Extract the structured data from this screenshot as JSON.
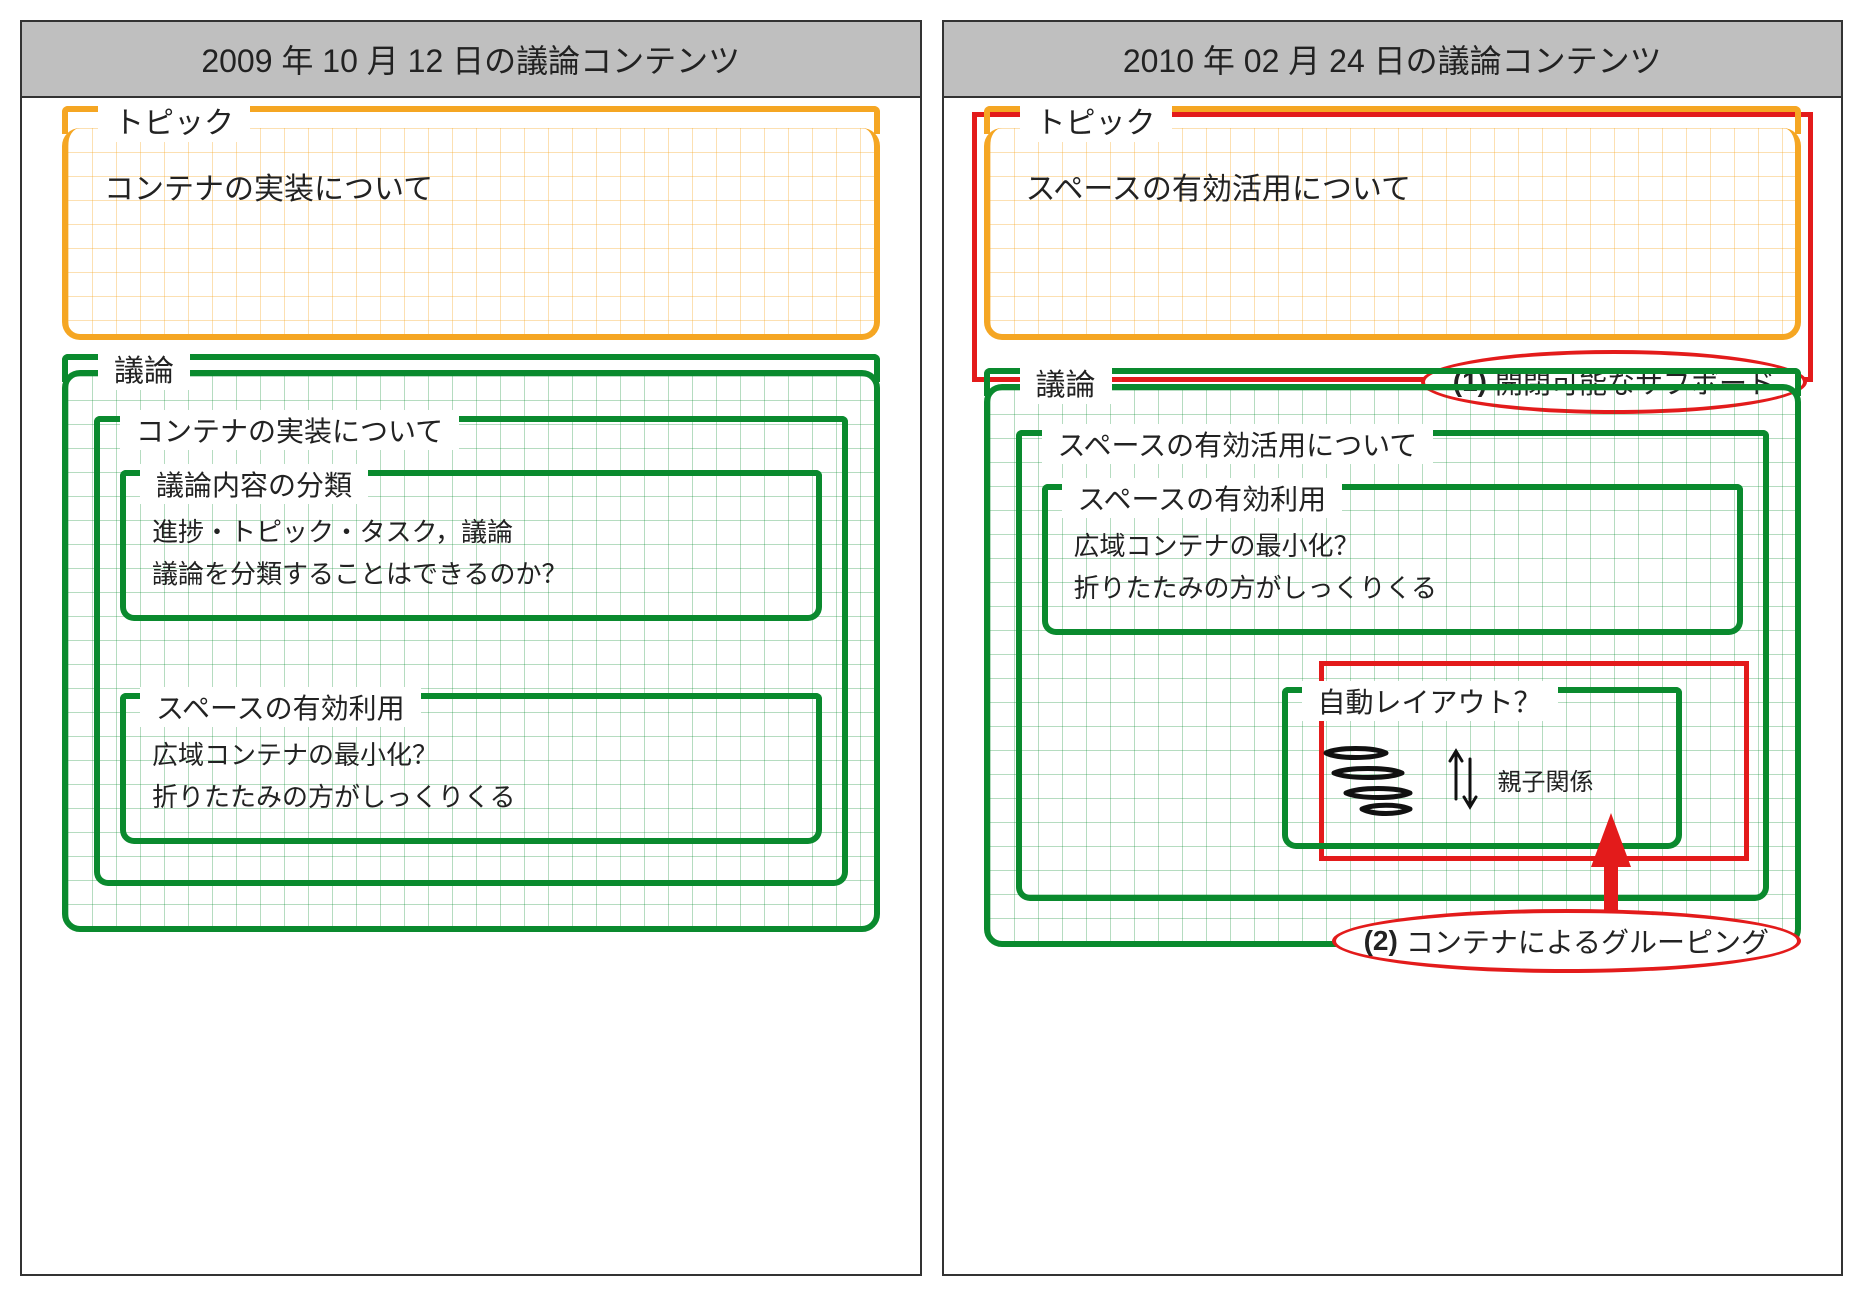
{
  "left": {
    "header": "2009 年 10 月 12 日の議論コンテンツ",
    "topic_label": "トピック",
    "topic_text": "コンテナの実装について",
    "discussion_label": "議論",
    "sub_title": "コンテナの実装について",
    "box1_label": "議論内容の分類",
    "box1_line1": "進捗・トピック・タスク，議論",
    "box1_line2": "議論を分類することはできるのか？",
    "box2_label": "スペースの有効利用",
    "box2_line1": "広域コンテナの最小化？",
    "box2_line2": "折りたたみの方がしっくりくる"
  },
  "right": {
    "header": "2010 年 02 月 24 日の議論コンテンツ",
    "topic_label": "トピック",
    "topic_text": "スペースの有効活用について",
    "discussion_label": "議論",
    "sub_title": "スペースの有効活用について",
    "box1_label": "スペースの有効利用",
    "box1_line1": "広域コンテナの最小化？",
    "box1_line2": "折りたたみの方がしっくりくる",
    "box2_label": "自動レイアウト？",
    "box2_note": "親子関係"
  },
  "callouts": {
    "c1_num": "(1)",
    "c1_text": "開閉可能なサブボード",
    "c2_num": "(2)",
    "c2_text": "コンテナによるグルーピング"
  }
}
